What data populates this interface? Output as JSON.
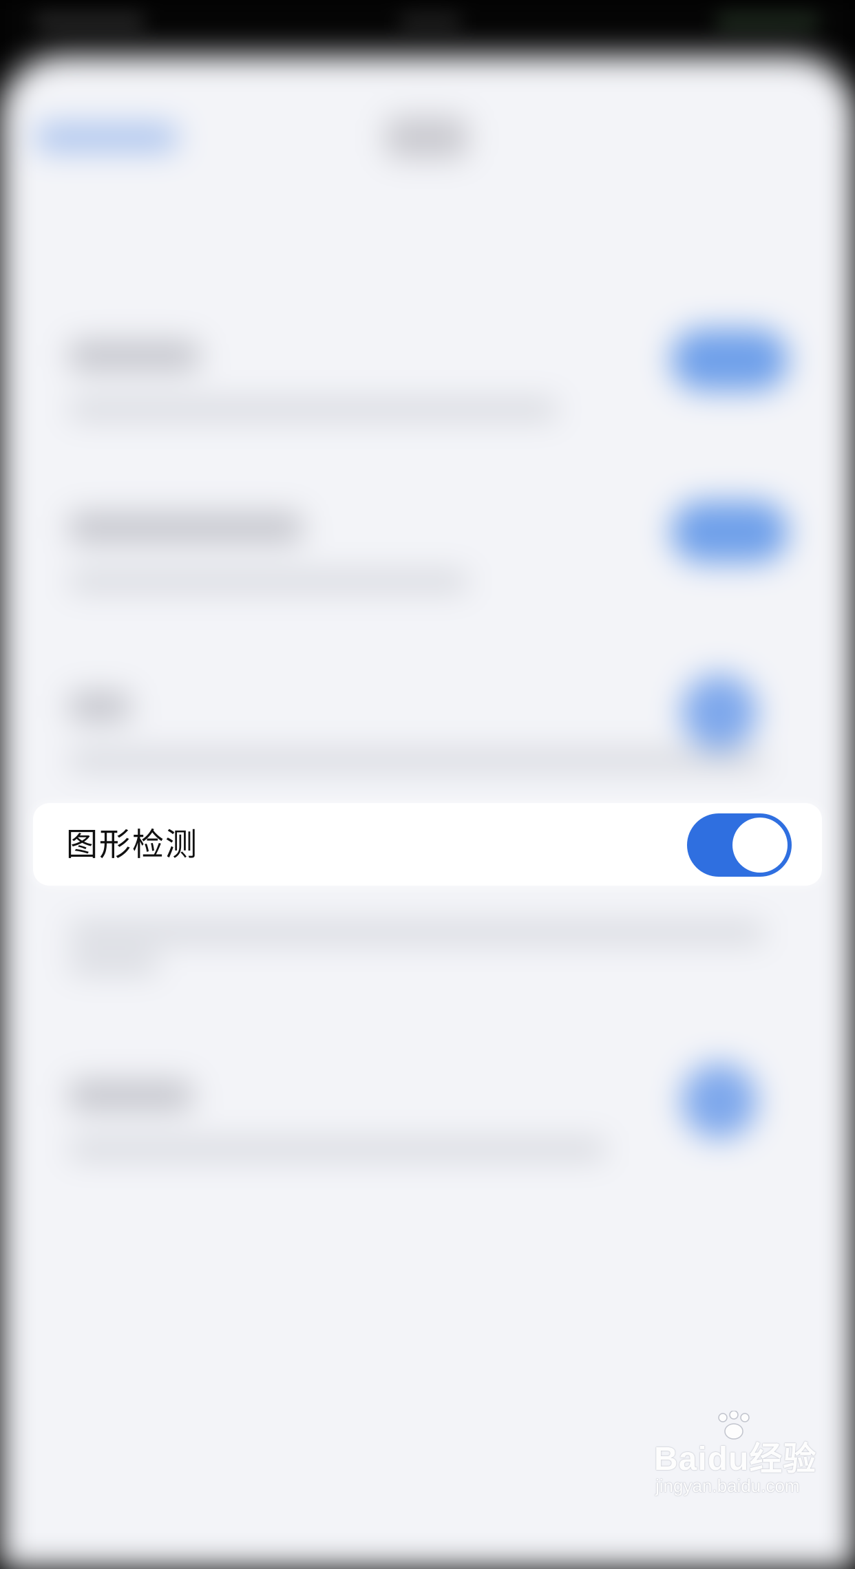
{
  "focused_setting": {
    "label": "图形检测",
    "enabled": true
  },
  "colors": {
    "accent": "#2f6fe0",
    "card_background": "#ffffff",
    "page_background": "#f3f4f8"
  },
  "watermark": {
    "brand": "Baidu经验",
    "url": "jingyan.baidu.com"
  }
}
